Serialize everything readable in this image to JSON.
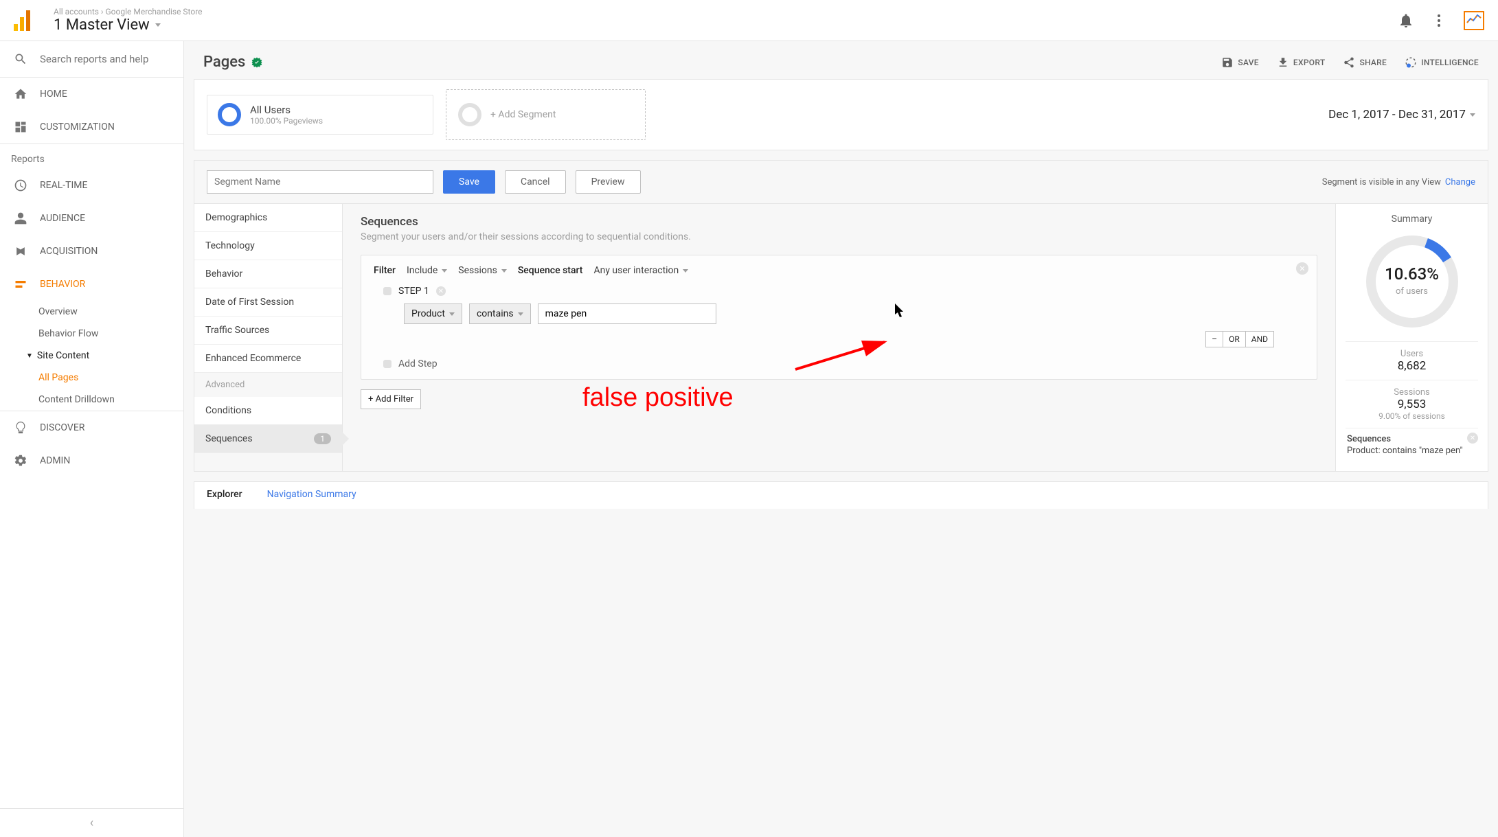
{
  "breadcrumb": {
    "parent": "All accounts",
    "child": "Google Merchandise Store"
  },
  "view_title": "1 Master View",
  "search_placeholder": "Search reports and help",
  "nav": {
    "home": "HOME",
    "customization": "CUSTOMIZATION",
    "reports_header": "Reports",
    "realtime": "REAL-TIME",
    "audience": "AUDIENCE",
    "acquisition": "ACQUISITION",
    "behavior": "BEHAVIOR",
    "behavior_sub": {
      "overview": "Overview",
      "flow": "Behavior Flow",
      "site_content": "Site Content",
      "all_pages": "All Pages",
      "drilldown": "Content Drilldown"
    },
    "discover": "DISCOVER",
    "admin": "ADMIN"
  },
  "page": {
    "title": "Pages",
    "actions": {
      "save": "SAVE",
      "export": "EXPORT",
      "share": "SHARE",
      "intelligence": "INTELLIGENCE"
    }
  },
  "segments": {
    "all_users": "All Users",
    "all_users_sub": "100.00% Pageviews",
    "add": "+ Add Segment",
    "date_range": "Dec 1, 2017 - Dec 31, 2017"
  },
  "builder": {
    "seg_name_placeholder": "Segment Name",
    "save": "Save",
    "cancel": "Cancel",
    "preview": "Preview",
    "visibility_text": "Segment is visible in any View",
    "change": "Change",
    "categories": {
      "demographics": "Demographics",
      "technology": "Technology",
      "behavior": "Behavior",
      "first_session": "Date of First Session",
      "traffic": "Traffic Sources",
      "ecommerce": "Enhanced Ecommerce",
      "advanced_header": "Advanced",
      "conditions": "Conditions",
      "sequences": "Sequences",
      "seq_count": "1"
    },
    "center": {
      "title": "Sequences",
      "subtitle": "Segment your users and/or their sessions according to sequential conditions.",
      "filter_label": "Filter",
      "include": "Include",
      "sessions": "Sessions",
      "seq_start_label": "Sequence start",
      "any_interaction": "Any user interaction",
      "step1": "STEP 1",
      "product": "Product",
      "contains": "contains",
      "value": "maze pen",
      "or": "OR",
      "and": "AND",
      "minus": "–",
      "add_step": "Add Step",
      "add_filter": "+ Add Filter"
    },
    "summary": {
      "title": "Summary",
      "pct": "10.63%",
      "pct_label": "of users",
      "users_label": "Users",
      "users_value": "8,682",
      "sessions_label": "Sessions",
      "sessions_value": "9,553",
      "sessions_pct": "9.00% of sessions",
      "seq_title": "Sequences",
      "seq_desc": "Product: contains \"maze pen\""
    }
  },
  "tabs": {
    "explorer": "Explorer",
    "nav_summary": "Navigation Summary"
  },
  "annotation": "false positive"
}
